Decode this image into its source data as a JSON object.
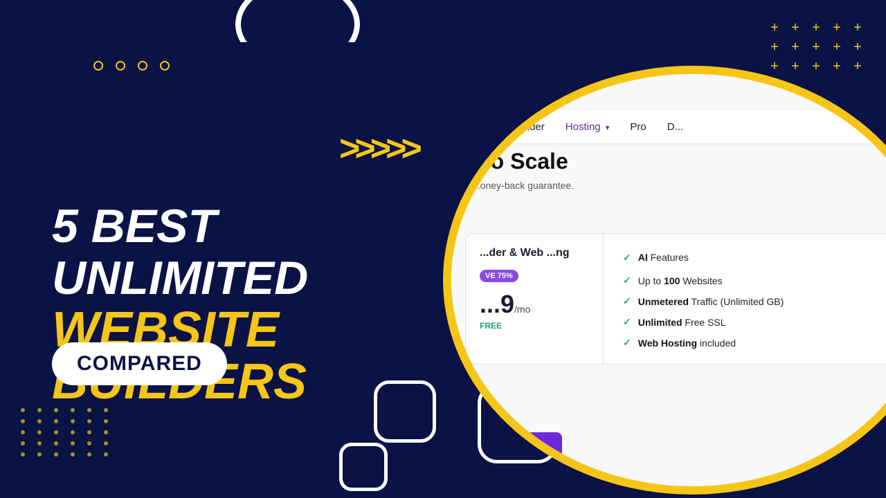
{
  "background": {
    "color": "#0a1246"
  },
  "decorative": {
    "dots_count": 4,
    "plus_grid_rows": 3,
    "plus_grid_cols": 5
  },
  "main_title": {
    "line1": "5 BEST UNLIMITED",
    "line2": "WEBSITE BUILDERS"
  },
  "compared_button": {
    "label": "COMPARED"
  },
  "chevrons": {
    "text": ">>>>>"
  },
  "site_preview": {
    "nav": {
      "items": [
        {
          "label": "Website Builder"
        },
        {
          "label": "Hosting",
          "has_arrow": true
        },
        {
          "label": "Pro"
        },
        {
          "label": "D..."
        }
      ]
    },
    "hero": {
      "title": "...o Scale",
      "subtitle": "...oney-back guarantee."
    },
    "plan": {
      "name": "...der & Web ...ng",
      "save_badge": "VE 75%",
      "price": "...9",
      "period": "/mo",
      "free_label": "FREE",
      "button_color": "#6d28d9"
    },
    "features": [
      {
        "text": "AI Features",
        "has_info": true
      },
      {
        "text": "Up to 100 Websites",
        "has_info": false
      },
      {
        "text": "Unmetered Traffic (Unlimited GB)",
        "has_info": false,
        "bold_part": "Unmetered"
      },
      {
        "text": "Unlimited Free SSL",
        "has_info": false,
        "bold_part": "Unlimited"
      },
      {
        "text": "Web Hosting included",
        "has_info": false,
        "bold_part": "Web Hosting"
      }
    ]
  }
}
